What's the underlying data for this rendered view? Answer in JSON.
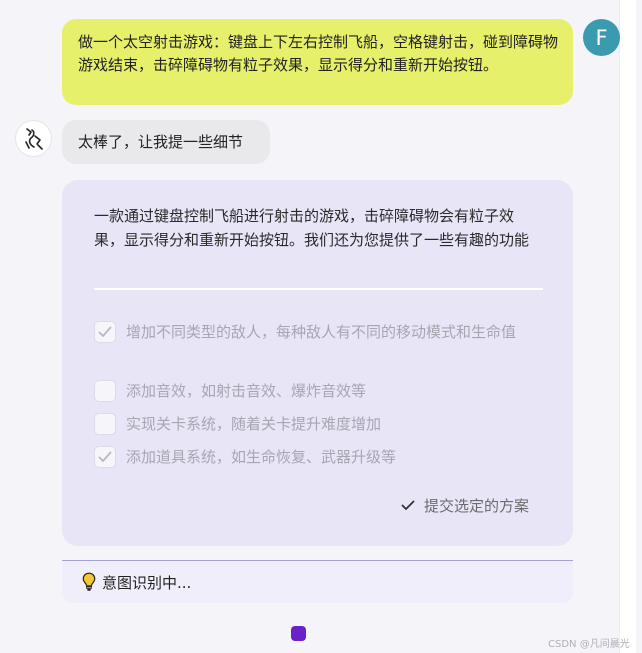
{
  "user_message": {
    "text": "做一个太空射击游戏：键盘上下左右控制飞船，空格键射击，碰到障碍物游戏结束，击碎障碍物有粒子效果，显示得分和重新开始按钮。",
    "avatar_letter": "F",
    "avatar_color": "#3a9bb0",
    "bubble_color": "#e6f06a"
  },
  "bot_reply": {
    "text": "太棒了，让我提一些细节",
    "avatar_icon": "robot-logo-icon"
  },
  "plan_card": {
    "description": "一款通过键盘控制飞船进行射击的游戏，击碎障碍物会有粒子效果，显示得分和重新开始按钮。我们还为您提供了一些有趣的功能",
    "options": [
      {
        "label": "增加不同类型的敌人，每种敌人有不同的移动模式和生命值",
        "checked": true
      },
      {
        "label": "添加音效，如射击音效、爆炸音效等",
        "checked": false
      },
      {
        "label": "实现关卡系统，随着关卡提升难度增加",
        "checked": false
      },
      {
        "label": "添加道具系统，如生命恢复、武器升级等",
        "checked": true
      }
    ],
    "submit_label": "提交选定的方案",
    "background_color": "#e8e5f7"
  },
  "intent_status": {
    "icon": "lightbulb-icon",
    "text": "意图识别中..."
  },
  "loading_color": "#6a22c8",
  "watermark": "CSDN @凡间晨光"
}
